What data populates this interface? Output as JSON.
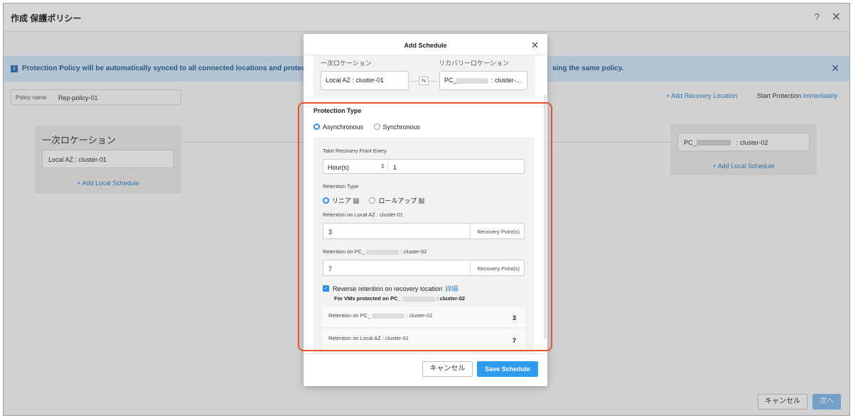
{
  "page": {
    "title": "作成 保護ポリシー",
    "help_icon": "?",
    "close_icon": "✕",
    "banner_icon": "i",
    "banner_text": "Protection Policy will be automatically synced to all connected locations and protect entities fr",
    "banner_text_end": "sing the same policy.",
    "banner_close": "✕",
    "policy_name_label": "Policy name",
    "policy_name_value": "Rep-policy-01",
    "add_recovery_location": "+ Add Recovery Location",
    "start_protection_prefix": "Start Protection ",
    "start_protection_link": "Immediately",
    "primary_location_title": "一次ロケーション",
    "primary_location_value": "Local AZ : cluster-01",
    "primary_add_schedule": "+ Add Local Schedule",
    "recovery_location_prefix": "PC_",
    "recovery_location_suffix": ": cluster-02",
    "recovery_add_schedule": "+ Add Local Schedule",
    "cancel_label": "キャンセル",
    "next_label": "次へ"
  },
  "modal": {
    "title": "Add Schedule",
    "close_icon": "✕",
    "primary_location_label": "一次ロケーション",
    "recovery_location_label": "リカバリーロケーション",
    "primary_location_value": "Local AZ : cluster-01",
    "recovery_prefix": "PC_",
    "recovery_suffix": ": cluster-...",
    "swap_icon": "⇆",
    "protection_type_label": "Protection Type",
    "protection_types": [
      "Asynchronous",
      "Synchronous"
    ],
    "protection_type_selected": "Asynchronous",
    "recovery_point_label": "Take Recovery Point Every",
    "recovery_unit": "Hour(s)",
    "recovery_unit_arrow": "⇕",
    "recovery_every": "1",
    "retention_type_label": "Retention Type",
    "retention_types": [
      "リニア",
      "ロールアップ"
    ],
    "retention_type_selected": "リニア",
    "retention_local_label": "Retention on Local AZ : cluster-01",
    "retention_local_value": "3",
    "retention_unit": "Recovery Point(s)",
    "retention_remote_prefix": "Retention on PC_",
    "retention_remote_suffix": ": cluster-02",
    "retention_remote_value": "7",
    "reverse_checkbox_label": "Reverse retention on recovery location",
    "reverse_checked": true,
    "reverse_link": "詳細",
    "for_vms_prefix": "For VMs protected on PC_",
    "for_vms_suffix": ": cluster-02",
    "reverse_rows": [
      {
        "label_prefix": "Retention on PC_",
        "label_suffix": ": cluster-02",
        "value": "3"
      },
      {
        "label": "Retention on Local AZ : cluster-01",
        "value": "7"
      }
    ],
    "cancel_label": "キャンセル",
    "save_label": "Save Schedule"
  },
  "colors": {
    "accent": "#2d9cf0",
    "link": "#2c7ec8",
    "banner": "#cfe2f3",
    "highlight": "#e8542a"
  }
}
